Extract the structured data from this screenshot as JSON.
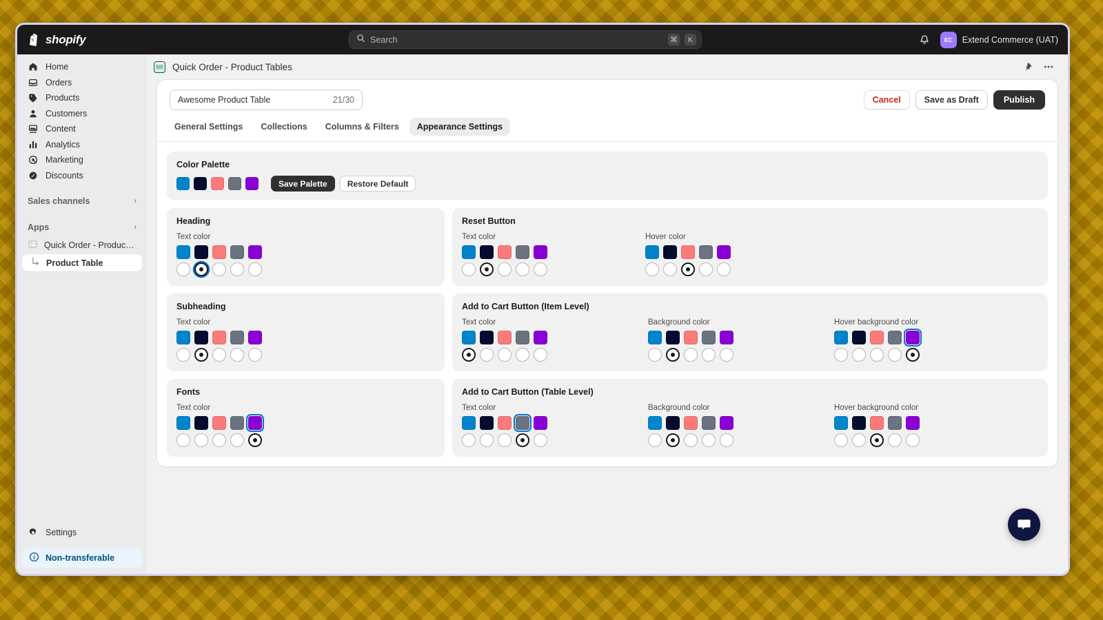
{
  "topbar": {
    "brand": "shopify",
    "search": {
      "placeholder": "Search",
      "kbd_mod": "⌘",
      "kbd_key": "K"
    },
    "user": {
      "initials": "EC",
      "name": "Extend Commerce (UAT)"
    }
  },
  "sidebar": {
    "items": [
      {
        "label": "Home",
        "icon": "home-icon"
      },
      {
        "label": "Orders",
        "icon": "orders-icon"
      },
      {
        "label": "Products",
        "icon": "products-icon"
      },
      {
        "label": "Customers",
        "icon": "customers-icon"
      },
      {
        "label": "Content",
        "icon": "content-icon"
      },
      {
        "label": "Analytics",
        "icon": "analytics-icon"
      },
      {
        "label": "Marketing",
        "icon": "marketing-icon"
      },
      {
        "label": "Discounts",
        "icon": "discounts-icon"
      }
    ],
    "sections": [
      {
        "label": "Sales channels"
      },
      {
        "label": "Apps"
      }
    ],
    "app": {
      "label": "Quick Order - Product Tab...",
      "sub_label": "Product Table"
    },
    "settings": {
      "label": "Settings"
    },
    "status_badge": {
      "label": "Non-transferable"
    }
  },
  "page": {
    "title": "Quick Order - Product Tables",
    "name_value": "Awesome Product Table",
    "name_count": "21/30",
    "buttons": {
      "cancel": "Cancel",
      "draft": "Save as Draft",
      "publish": "Publish"
    },
    "tabs": [
      {
        "label": "General Settings",
        "active": false
      },
      {
        "label": "Collections",
        "active": false
      },
      {
        "label": "Columns & Filters",
        "active": false
      },
      {
        "label": "Appearance Settings",
        "active": true
      }
    ]
  },
  "palette": {
    "title": "Color Palette",
    "colors": [
      "#0084CC",
      "#050B2E",
      "#FB7A7A",
      "#6B7280",
      "#8A00D4"
    ],
    "save_label": "Save Palette",
    "restore_label": "Restore Default"
  },
  "settings_cards": {
    "heading": {
      "title": "Heading",
      "groups": [
        {
          "label": "Text color",
          "selected": 1,
          "focus_ring": true,
          "swatch_focus": -1
        }
      ]
    },
    "subheading": {
      "title": "Subheading",
      "groups": [
        {
          "label": "Text color",
          "selected": 1,
          "focus_ring": false,
          "swatch_focus": -1
        }
      ]
    },
    "fonts": {
      "title": "Fonts",
      "groups": [
        {
          "label": "Text color",
          "selected": 4,
          "focus_ring": false,
          "swatch_focus": 4
        }
      ]
    },
    "reset_button": {
      "title": "Reset Button",
      "groups": [
        {
          "label": "Text color",
          "selected": 1,
          "focus_ring": false,
          "swatch_focus": -1
        },
        {
          "label": "Hover color",
          "selected": 2,
          "focus_ring": false,
          "swatch_focus": -1
        }
      ]
    },
    "add_to_cart_item": {
      "title": "Add to Cart Button (Item Level)",
      "groups": [
        {
          "label": "Text color",
          "selected": 0,
          "focus_ring": false,
          "swatch_focus": -1
        },
        {
          "label": "Background color",
          "selected": 1,
          "focus_ring": false,
          "swatch_focus": -1
        },
        {
          "label": "Hover background color",
          "selected": 4,
          "focus_ring": false,
          "swatch_focus": 4
        }
      ]
    },
    "add_to_cart_table": {
      "title": "Add to Cart Button (Table Level)",
      "groups": [
        {
          "label": "Text color",
          "selected": 3,
          "focus_ring": false,
          "swatch_focus": 3
        },
        {
          "label": "Background color",
          "selected": 1,
          "focus_ring": false,
          "swatch_focus": -1
        },
        {
          "label": "Hover background color",
          "selected": 2,
          "focus_ring": false,
          "swatch_focus": -1
        }
      ]
    }
  }
}
